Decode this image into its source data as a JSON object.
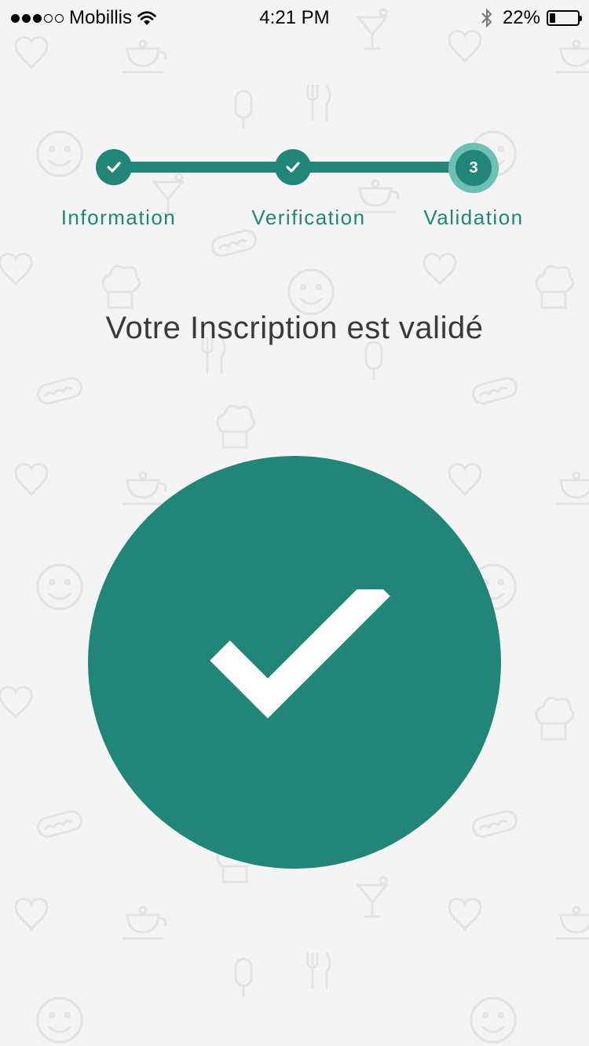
{
  "status_bar": {
    "carrier": "Mobillis",
    "signal_filled": 3,
    "signal_total": 5,
    "time": "4:21 PM",
    "battery_percent_label": "22%",
    "battery_level": 0.22,
    "icons": [
      "wifi-icon",
      "bluetooth-icon",
      "battery-icon"
    ]
  },
  "stepper": {
    "steps": [
      {
        "label": "Information",
        "state": "done",
        "icon": "check-icon"
      },
      {
        "label": "Verification",
        "state": "done",
        "icon": "check-icon"
      },
      {
        "label": "Validation",
        "state": "active",
        "number": "3"
      }
    ]
  },
  "main": {
    "title": "Votre Inscription est validé",
    "success_icon": "check-circle-icon"
  },
  "colors": {
    "accent": "#218678",
    "accent_light": "#6cc1b4",
    "background": "#f4f4f4",
    "pattern": "#e3e3e3",
    "title_text": "#3a3a3a"
  }
}
